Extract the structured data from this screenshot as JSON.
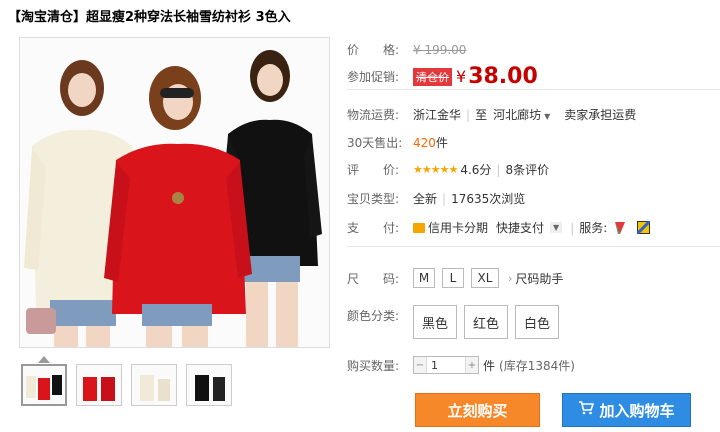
{
  "product": {
    "title": "【淘宝清仓】超显瘦2种穿法长袖雪纺衬衫 3色入"
  },
  "price": {
    "label": "价　　格:",
    "original": "¥ 199.00",
    "promo_label": "参加促销:",
    "promo_tag": "清仓价",
    "yen": "¥",
    "current": "38.00"
  },
  "shipping": {
    "label": "物流运费:",
    "from": "浙江金华",
    "to_prefix": "至",
    "to": "河北廊坊",
    "fee": "卖家承担运费"
  },
  "sales": {
    "label": "30天售出:",
    "count": "420",
    "unit": "件"
  },
  "rating": {
    "label": "评　　价:",
    "stars": "★★★★★",
    "score": "4.6分",
    "reviews": "8条评价"
  },
  "product_type": {
    "label": "宝贝类型:",
    "condition": "全新",
    "views": "17635次浏览"
  },
  "payment": {
    "label": "支　　付:",
    "credit": "信用卡分期",
    "quick": "快捷支付",
    "service_label": "服务:"
  },
  "size": {
    "label": "尺　　码:",
    "options": [
      "M",
      "L",
      "XL"
    ],
    "helper": "尺码助手"
  },
  "color": {
    "label": "颜色分类:",
    "options": [
      "黑色",
      "红色",
      "白色"
    ]
  },
  "quantity": {
    "label": "购买数量:",
    "value": "1",
    "unit": "件",
    "stock": "(库存1384件)"
  },
  "actions": {
    "buy_now": "立刻购买",
    "add_cart": "加入购物车"
  },
  "colors": {
    "price_red": "#c40000",
    "buy_orange": "#f7882a",
    "cart_blue": "#2e8ce3"
  }
}
